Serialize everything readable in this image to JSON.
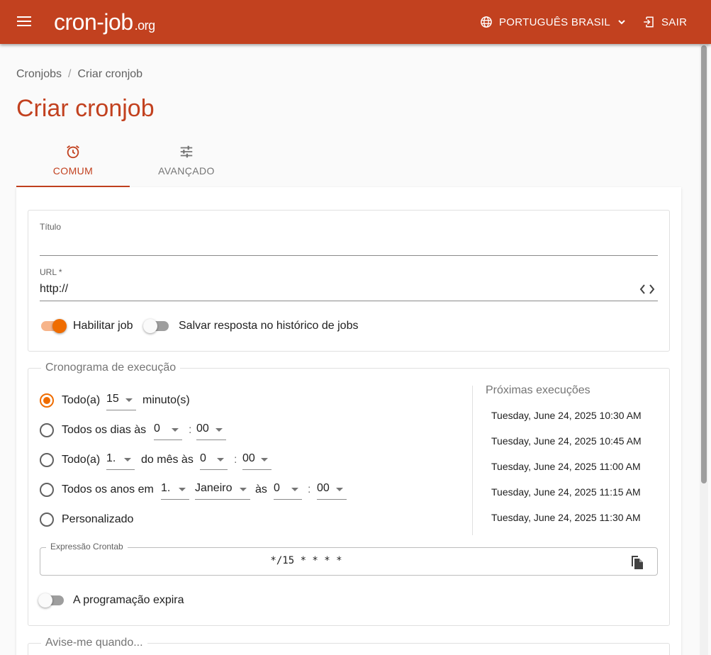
{
  "header": {
    "logo_main": "cron-job",
    "logo_tld": ".org",
    "language": "PORTUGUÊS BRASIL",
    "logout": "SAIR",
    "bg_color": "#c2411f"
  },
  "breadcrumb": {
    "root": "Cronjobs",
    "separator": "/",
    "current": "Criar cronjob"
  },
  "page_title": "Criar cronjob",
  "tabs": [
    {
      "label": "COMUM",
      "icon": "alarm-clock-icon",
      "active": true
    },
    {
      "label": "AVANÇADO",
      "icon": "tune-sliders-icon",
      "active": false
    }
  ],
  "form": {
    "title_label": "Título",
    "title_value": "",
    "url_label": "URL *",
    "url_value": "http://",
    "enable_job_label": "Habilitar job",
    "enable_job_on": true,
    "save_response_label": "Salvar resposta no histórico de jobs",
    "save_response_on": false
  },
  "schedule": {
    "legend": "Cronograma de execução",
    "every_prefix": "Todo(a)",
    "every_value": "15",
    "every_unit": "minuto(s)",
    "daily_text": "Todos os dias às",
    "daily_hour": "0",
    "daily_minute": "00",
    "monthly_prefix": "Todo(a)",
    "monthly_day": "1.",
    "monthly_mid": "do mês às",
    "monthly_hour": "0",
    "monthly_minute": "00",
    "yearly_text": "Todos os anos em",
    "yearly_day": "1.",
    "yearly_month": "Janeiro",
    "yearly_at": "às",
    "yearly_hour": "0",
    "yearly_minute": "00",
    "custom_label": "Personalizado",
    "colon": ":",
    "selected_option": "every"
  },
  "next_runs": {
    "title": "Próximas execuções",
    "items": [
      "Tuesday, June 24, 2025 10:30 AM",
      "Tuesday, June 24, 2025 10:45 AM",
      "Tuesday, June 24, 2025 11:00 AM",
      "Tuesday, June 24, 2025 11:15 AM",
      "Tuesday, June 24, 2025 11:30 AM"
    ]
  },
  "crontab": {
    "label": "Expressão Crontab",
    "value": "*/15 * * * *",
    "copy_icon": "copy-icon"
  },
  "expires": {
    "label": "A programação expira",
    "on": false
  },
  "notify": {
    "legend": "Avise-me quando..."
  },
  "colors": {
    "accent": "#c2411f",
    "toggle_accent": "#ef6c00"
  }
}
